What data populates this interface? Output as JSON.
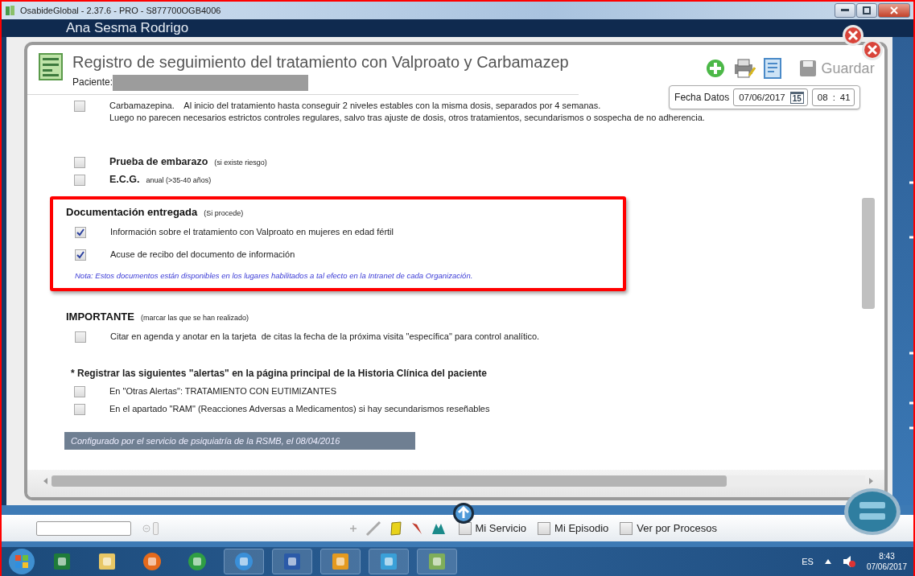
{
  "window": {
    "title": "OsabideGlobal - 2.37.6 - PRO - S877700OGB4006"
  },
  "header": {
    "name": "Ana Sesma Rodrigo"
  },
  "dialog": {
    "title": "Registro de seguimiento del tratamiento con Valproato y Carbamazep",
    "patient_label": "Paciente:",
    "save_label": "Guardar",
    "save_disabled": true,
    "date": {
      "label": "Fecha Datos",
      "value": "07/06/2017",
      "calendar_day": "15",
      "hour": "08",
      "separator": ":",
      "minute": "41"
    }
  },
  "blocks": [
    {
      "kind": "item",
      "checked": false,
      "lines": [
        "Carbamazepina.    Al inicio del tratamiento hasta conseguir 2 niveles estables con la misma dosis, separados por 4 semanas.",
        "Luego no parecen necesarios estrictos controles regulares, salvo tras ajuste de dosis, otros tratamientos, secundarismos o sospecha de no adherencia."
      ]
    },
    {
      "kind": "item",
      "checked": false,
      "label": "Prueba de embarazo",
      "hint": "(si existe riesgo)"
    },
    {
      "kind": "item",
      "checked": false,
      "label": "E.C.G.",
      "hint": "anual (>35-40 años)"
    },
    {
      "kind": "section",
      "highlighted": true,
      "heading": "Documentación entregada",
      "hint": "(Si procede)",
      "items": [
        {
          "checked": true,
          "text": "Información sobre el tratamiento con Valproato en mujeres en edad fértil"
        },
        {
          "checked": true,
          "text": "Acuse de recibo del documento de información"
        }
      ],
      "note": "Nota: Estos documentos están disponibles en los lugares habilitados a tal efecto en la Intranet de cada Organización."
    },
    {
      "kind": "section",
      "highlighted": false,
      "heading": "IMPORTANTE",
      "hint": "(marcar las que se han realizado)",
      "items": [
        {
          "checked": false,
          "text": "Citar en agenda y anotar en la tarjeta  de citas la fecha de la próxima visita \"específica\" para control analítico."
        }
      ]
    },
    {
      "kind": "subheading",
      "text": "* Registrar las siguientes \"alertas\" en la página principal de la Historia Clínica del paciente"
    },
    {
      "kind": "item",
      "checked": false,
      "lines": [
        "En \"Otras Alertas\": TRATAMIENTO CON EUTIMIZANTES"
      ]
    },
    {
      "kind": "item",
      "checked": false,
      "lines": [
        "En el apartado \"RAM\" (Reacciones Adversas a Medicamentos) si hay secundarismos reseñables"
      ]
    },
    {
      "kind": "footer",
      "text": "Configurado por el servicio de psiquiatría de la RSMB, el 08/04/2016"
    }
  ],
  "bottom_bar": {
    "filters": [
      {
        "label": "Mi Servicio",
        "checked": false
      },
      {
        "label": "Mi Episodio",
        "checked": false
      },
      {
        "label": "Ver por Procesos",
        "checked": false
      }
    ]
  },
  "taskbar": {
    "language": "ES",
    "time": "8:43",
    "date": "07/06/2017"
  }
}
